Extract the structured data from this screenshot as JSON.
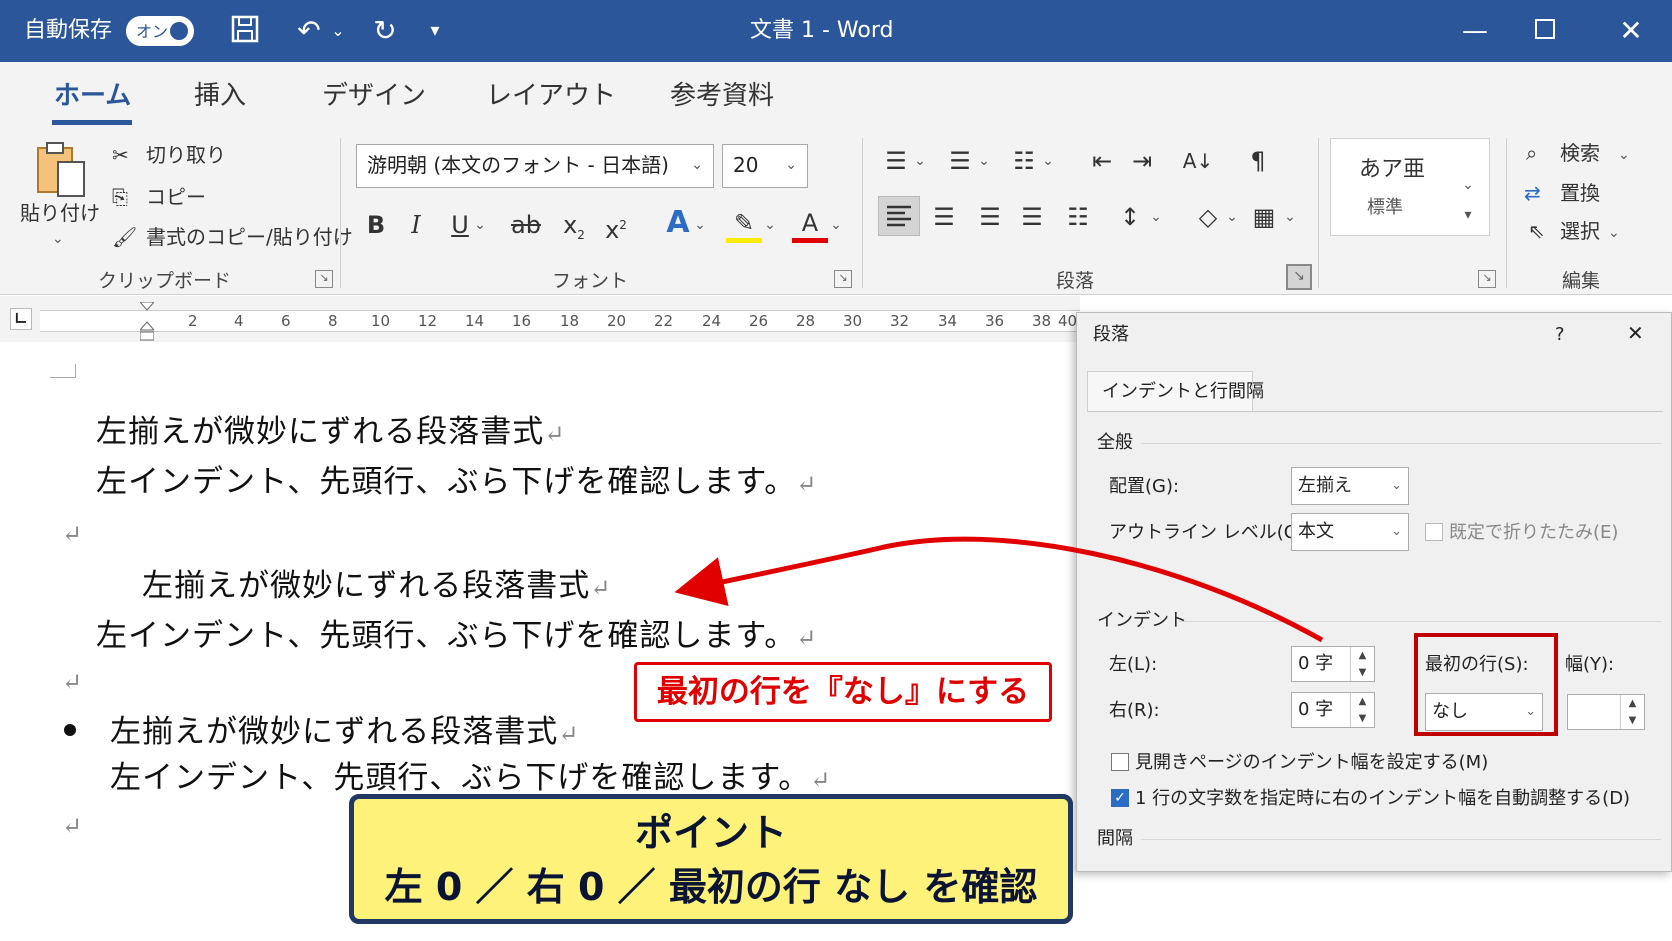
{
  "titlebar": {
    "autosave_label": "自動保存",
    "autosave_state": "オン",
    "doc_title": "文書 1  -  Word",
    "bg_color": "#2b579a"
  },
  "tabs": [
    "ホーム",
    "挿入",
    "デザイン",
    "レイアウト",
    "参考資料"
  ],
  "ribbon": {
    "clipboard": {
      "paste": "貼り付け",
      "cut": "切り取り",
      "copy": "コピー",
      "format_painter": "書式のコピー/貼り付け",
      "group": "クリップボード"
    },
    "font": {
      "font_name": "游明朝 (本文のフォント - 日本語)",
      "font_size": "20",
      "group": "フォント"
    },
    "paragraph": {
      "group": "段落"
    },
    "styles": {
      "sample": "あア亜",
      "name": "標準"
    },
    "editing": {
      "find": "検索",
      "replace": "置換",
      "select": "選択",
      "group": "編集"
    }
  },
  "ruler": {
    "numbers": [
      "2",
      "4",
      "6",
      "8",
      "10",
      "12",
      "14",
      "16",
      "18",
      "20",
      "22",
      "24",
      "26",
      "28",
      "30",
      "32",
      "34",
      "36",
      "38",
      "40"
    ]
  },
  "document": {
    "line_a": "左揃えが微妙にずれる段落書式",
    "line_b": "左インデント、先頭行、ぶら下げを確認します。",
    "para_mark": "↵"
  },
  "dialog": {
    "title": "段落",
    "help": "?",
    "close": "✕",
    "tab": "インデントと行間隔",
    "general": "全般",
    "alignment_label": "配置(G):",
    "alignment_value": "左揃え",
    "outline_label": "アウトライン レベル(O):",
    "outline_value": "本文",
    "collapsed_label": "既定で折りたたみ(E)",
    "indent": "インデント",
    "left_label": "左(L):",
    "left_value": "0 字",
    "right_label": "右(R):",
    "right_value": "0 字",
    "special_label": "最初の行(S):",
    "special_value": "なし",
    "by_label": "幅(Y):",
    "mirror_label": "見開きページのインデント幅を設定する(M)",
    "auto_adjust_label": "1 行の文字数を指定時に右のインデント幅を自動調整する(D)",
    "spacing": "間隔"
  },
  "callouts": {
    "red": "最初の行を『なし』にする",
    "point_title": "ポイント",
    "point_body": "左 0 ／ 右 0 ／ 最初の行 なし を確認"
  }
}
